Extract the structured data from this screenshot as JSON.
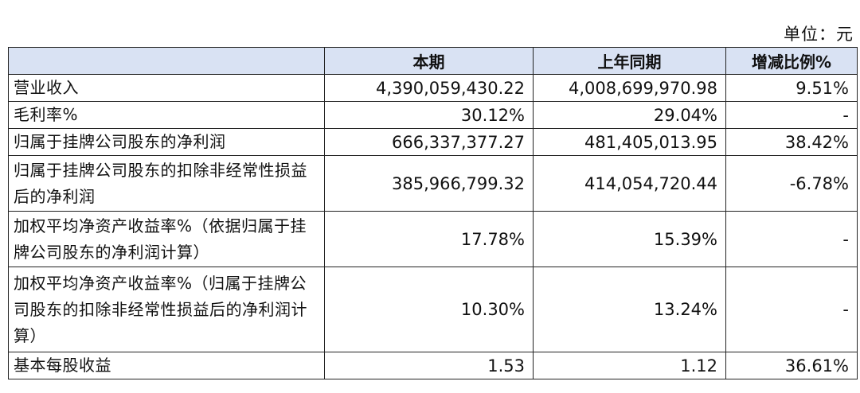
{
  "unit_label": "单位：元",
  "headers": [
    "",
    "本期",
    "上年同期",
    "增减比例%"
  ],
  "rows": [
    {
      "label": "营业收入",
      "current": "4,390,059,430.22",
      "previous": "4,008,699,970.98",
      "change": "9.51%"
    },
    {
      "label": "毛利率%",
      "current": "30.12%",
      "previous": "29.04%",
      "change": "-"
    },
    {
      "label": "归属于挂牌公司股东的净利润",
      "current": "666,337,377.27",
      "previous": "481,405,013.95",
      "change": "38.42%"
    },
    {
      "label": "归属于挂牌公司股东的扣除非经常性损益后的净利润",
      "current": "385,966,799.32",
      "previous": "414,054,720.44",
      "change": "-6.78%"
    },
    {
      "label": "加权平均净资产收益率%（依据归属于挂牌公司股东的净利润计算）",
      "current": "17.78%",
      "previous": "15.39%",
      "change": "-"
    },
    {
      "label": "加权平均净资产收益率%（归属于挂牌公司股东的扣除非经常性损益后的净利润计算）",
      "current": "10.30%",
      "previous": "13.24%",
      "change": "-"
    },
    {
      "label": "基本每股收益",
      "current": "1.53",
      "previous": "1.12",
      "change": "36.61%"
    }
  ]
}
